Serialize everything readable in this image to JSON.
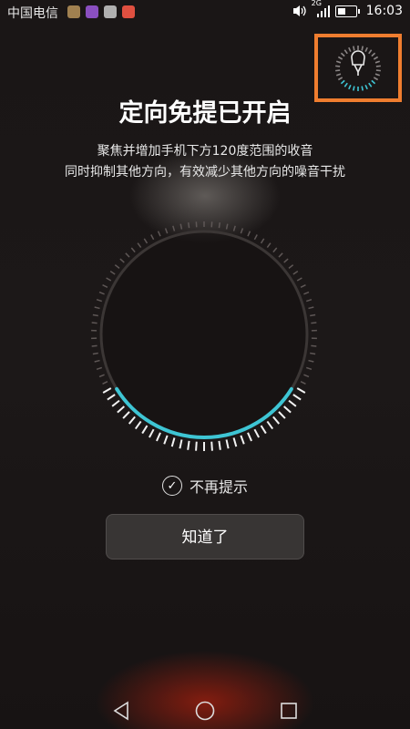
{
  "status_bar": {
    "carrier": "中国电信",
    "network": "2G",
    "time": "16:03",
    "icons": [
      "app-icon-1",
      "app-icon-2",
      "app-icon-3",
      "app-icon-4",
      "vibrate-icon",
      "signal-icon",
      "battery-icon"
    ]
  },
  "dialog": {
    "title": "定向免提已开启",
    "line1": "聚焦并增加手机下方120度范围的收音",
    "line2": "同时抑制其他方向，有效减少其他方向的噪音干扰",
    "checkbox_label": "不再提示",
    "checkbox_checked": true,
    "ok_button": "知道了"
  },
  "colors": {
    "accent": "#3ec5d4",
    "highlight": "#ef7d2f",
    "background": "#1a1616"
  }
}
